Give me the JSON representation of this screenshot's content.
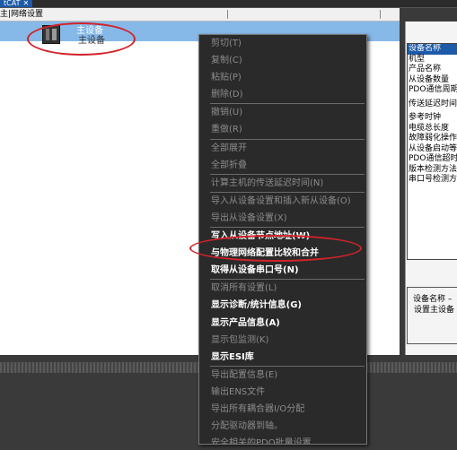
{
  "tab": {
    "label": "tCAT",
    "close": "✕"
  },
  "network": {
    "header_label": "主|网络设置"
  },
  "device": {
    "name": "主设备",
    "sub": "主设备"
  },
  "properties": {
    "rows": [
      "设备名称",
      "机型",
      "产品名称",
      "从设备数量",
      "PDO通信周期",
      "传送延迟时间",
      "参考时钟",
      "电缆总长度",
      "故障弱化操作",
      "从设备启动等",
      "PDO通信超时",
      "版本检测方法",
      "串口号检测方"
    ]
  },
  "description": {
    "title": "设备名称 –",
    "value": "设置主设备"
  },
  "context_menu": {
    "items": [
      {
        "label": "剪切(T)",
        "enabled": false
      },
      {
        "label": "复制(C)",
        "enabled": false
      },
      {
        "label": "粘贴(P)",
        "enabled": false
      },
      {
        "label": "删除(D)",
        "enabled": false
      },
      {
        "sep": true
      },
      {
        "label": "撤销(U)",
        "enabled": false
      },
      {
        "label": "重做(R)",
        "enabled": false
      },
      {
        "sep": true
      },
      {
        "label": "全部展开",
        "enabled": false
      },
      {
        "label": "全部折叠",
        "enabled": false
      },
      {
        "sep": true
      },
      {
        "label": "计算主机的传送延迟时间(N)",
        "enabled": false
      },
      {
        "sep": true
      },
      {
        "label": "导入从设备设置和插入新从设备(O)",
        "enabled": false
      },
      {
        "label": "导出从设备设置(X)",
        "enabled": false
      },
      {
        "sep": true
      },
      {
        "label": "写入从设备节点地址(W)",
        "enabled": true
      },
      {
        "label": "与物理网络配置比较和合并",
        "enabled": true
      },
      {
        "label": "取得从设备串口号(N)",
        "enabled": true
      },
      {
        "sep": true
      },
      {
        "label": "取消所有设置(L)",
        "enabled": false
      },
      {
        "label": "显示诊断/统计信息(G)",
        "enabled": true
      },
      {
        "label": "显示产品信息(A)",
        "enabled": true
      },
      {
        "label": "显示包监测(K)",
        "enabled": false
      },
      {
        "label": "显示ESI库",
        "enabled": true
      },
      {
        "sep": true
      },
      {
        "label": "导出配置信息(E)",
        "enabled": false
      },
      {
        "label": "输出ENS文件",
        "enabled": false
      },
      {
        "label": "导出所有耦合器I/O分配",
        "enabled": false
      },
      {
        "label": "分配驱动器到轴。",
        "enabled": false
      },
      {
        "label": "安全相关的PDO批量设置",
        "enabled": false
      }
    ]
  },
  "colors": {
    "annotation": "#d2232a",
    "selection": "#86b8e8",
    "menu_bg": "#2a2a2a"
  }
}
